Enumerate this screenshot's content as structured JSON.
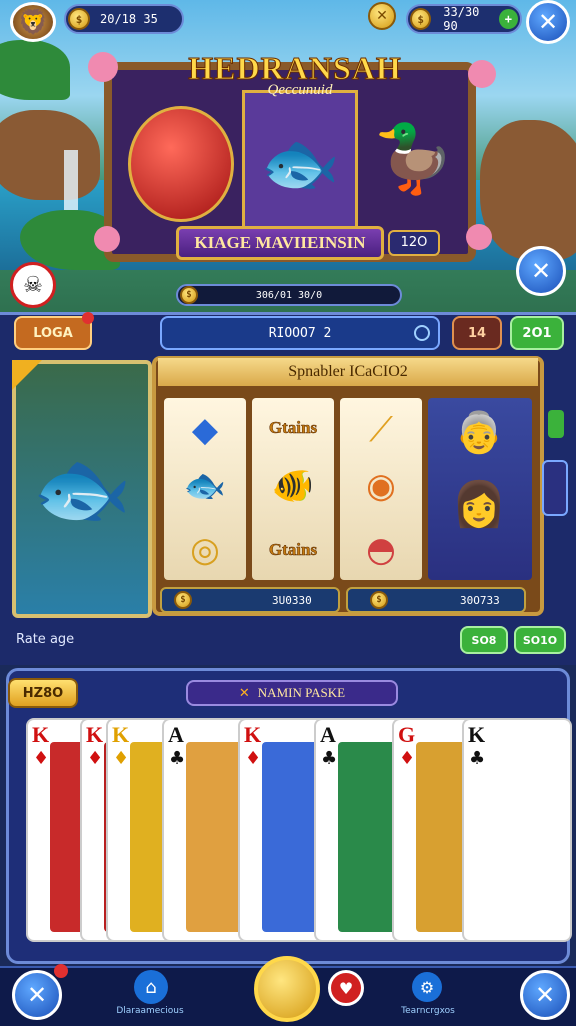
{
  "top_bar": {
    "left_currency": "20/18 35",
    "right_currency": "33/30 90",
    "coin_symbol": "$"
  },
  "banner": {
    "title": "HEDRANSAH",
    "subtitle": "Qeccunuid",
    "ribbon_text": "KIAGE MAVIIEINSIN",
    "ribbon_badge": "12O"
  },
  "progress_text": "306/01 30/0",
  "panel_header": {
    "left_tab": "LOGA",
    "center_value": "RIOOO7 2",
    "right_btn_1": "14",
    "right_btn_2": "2O1"
  },
  "slot": {
    "title": "Spnabler ICaCIO2",
    "reel_text": [
      "Gtains",
      "Gtains"
    ],
    "credit_left": "3U0330",
    "credit_right": "30O733",
    "side_label": "Rate age",
    "btn_1": "SO8",
    "btn_2": "SO1O"
  },
  "cards_section": {
    "left_badge": "HZ8O",
    "title": "NAMIN PASKE",
    "cards": [
      {
        "rank": "K",
        "suit": "♦",
        "color": "#d01010"
      },
      {
        "rank": "K",
        "suit": "♦",
        "color": "#d01010"
      },
      {
        "rank": "K",
        "suit": "♦",
        "color": "#e0a000"
      },
      {
        "rank": "A",
        "suit": "♣",
        "color": "#111111"
      },
      {
        "rank": "K",
        "suit": "♦",
        "color": "#d01010"
      },
      {
        "rank": "A",
        "suit": "♣",
        "color": "#111111"
      },
      {
        "rank": "G",
        "suit": "♦",
        "color": "#d01010"
      },
      {
        "rank": "K",
        "suit": "♣",
        "color": "#111111"
      }
    ]
  },
  "bottom_nav": {
    "label_1": "Dlaraamecious",
    "label_2": "Tearncrgxos"
  },
  "colors": {
    "panel": "#1c2a6a",
    "accent_gold": "#ffd84a",
    "accent_green": "#3bb23b",
    "button_blue": "#1a4fb8"
  }
}
